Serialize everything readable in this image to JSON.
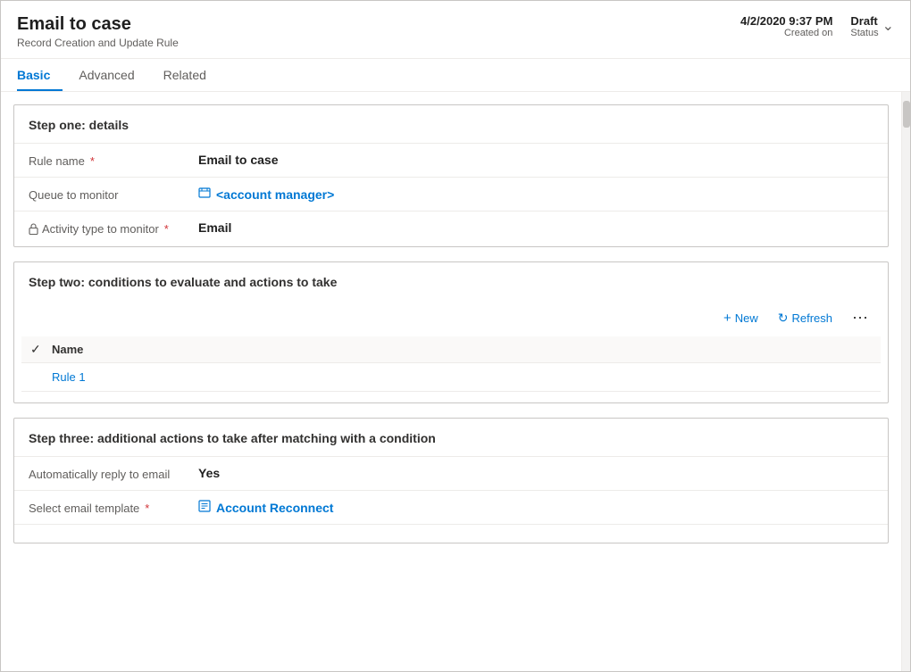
{
  "header": {
    "title": "Email to case",
    "subtitle": "Record Creation and Update Rule",
    "date_value": "4/2/2020 9:37 PM",
    "date_label": "Created on",
    "status_value": "Draft",
    "status_label": "Status"
  },
  "tabs": [
    {
      "id": "basic",
      "label": "Basic",
      "active": true
    },
    {
      "id": "advanced",
      "label": "Advanced",
      "active": false
    },
    {
      "id": "related",
      "label": "Related",
      "active": false
    }
  ],
  "step_one": {
    "title": "Step one: details",
    "fields": [
      {
        "label": "Rule name",
        "required": true,
        "locked": false,
        "value": "Email to case",
        "value_type": "text"
      },
      {
        "label": "Queue to monitor",
        "required": false,
        "locked": false,
        "value": "<account manager>",
        "value_type": "link",
        "icon": "queue"
      },
      {
        "label": "Activity type to monitor",
        "required": true,
        "locked": true,
        "value": "Email",
        "value_type": "text"
      }
    ]
  },
  "step_two": {
    "title": "Step two: conditions to evaluate and actions to take",
    "toolbar": {
      "new_label": "New",
      "refresh_label": "Refresh"
    },
    "table": {
      "column": "Name",
      "rows": [
        {
          "name": "Rule 1"
        }
      ]
    }
  },
  "step_three": {
    "title": "Step three: additional actions to take after matching with a condition",
    "fields": [
      {
        "label": "Automatically reply to email",
        "required": false,
        "locked": false,
        "value": "Yes",
        "value_type": "text"
      },
      {
        "label": "Select email template",
        "required": true,
        "locked": false,
        "value": "Account Reconnect",
        "value_type": "link",
        "icon": "template"
      }
    ]
  }
}
